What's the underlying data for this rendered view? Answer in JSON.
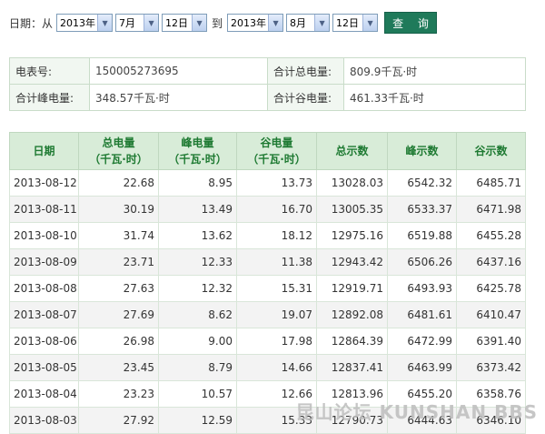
{
  "filter": {
    "date_label": "日期：从",
    "from": {
      "year": "2013年",
      "month": "7月",
      "day": "12日"
    },
    "to_label": "到",
    "to": {
      "year": "2013年",
      "month": "8月",
      "day": "12日"
    },
    "query_label": "查 询"
  },
  "info": {
    "meter_no_label": "电表号:",
    "meter_no": "150005273695",
    "total_label": "合计总电量:",
    "total": "809.9千瓦·时",
    "peak_label": "合计峰电量:",
    "peak": "348.57千瓦·时",
    "valley_label": "合计谷电量:",
    "valley": "461.33千瓦·时"
  },
  "table": {
    "headers": [
      {
        "l1": "日期",
        "l2": ""
      },
      {
        "l1": "总电量",
        "l2": "（千瓦·时）"
      },
      {
        "l1": "峰电量",
        "l2": "（千瓦·时）"
      },
      {
        "l1": "谷电量",
        "l2": "（千瓦·时）"
      },
      {
        "l1": "总示数",
        "l2": ""
      },
      {
        "l1": "峰示数",
        "l2": ""
      },
      {
        "l1": "谷示数",
        "l2": ""
      }
    ],
    "rows": [
      [
        "2013-08-12",
        "22.68",
        "8.95",
        "13.73",
        "13028.03",
        "6542.32",
        "6485.71"
      ],
      [
        "2013-08-11",
        "30.19",
        "13.49",
        "16.70",
        "13005.35",
        "6533.37",
        "6471.98"
      ],
      [
        "2013-08-10",
        "31.74",
        "13.62",
        "18.12",
        "12975.16",
        "6519.88",
        "6455.28"
      ],
      [
        "2013-08-09",
        "23.71",
        "12.33",
        "11.38",
        "12943.42",
        "6506.26",
        "6437.16"
      ],
      [
        "2013-08-08",
        "27.63",
        "12.32",
        "15.31",
        "12919.71",
        "6493.93",
        "6425.78"
      ],
      [
        "2013-08-07",
        "27.69",
        "8.62",
        "19.07",
        "12892.08",
        "6481.61",
        "6410.47"
      ],
      [
        "2013-08-06",
        "26.98",
        "9.00",
        "17.98",
        "12864.39",
        "6472.99",
        "6391.40"
      ],
      [
        "2013-08-05",
        "23.45",
        "8.79",
        "14.66",
        "12837.41",
        "6463.99",
        "6373.42"
      ],
      [
        "2013-08-04",
        "23.23",
        "10.57",
        "12.66",
        "12813.96",
        "6455.20",
        "6358.76"
      ],
      [
        "2013-08-03",
        "27.92",
        "12.59",
        "15.33",
        "12790.73",
        "6444.63",
        "6346.10"
      ]
    ]
  },
  "watermark": "昆山论坛 KUNSHAN BBS"
}
